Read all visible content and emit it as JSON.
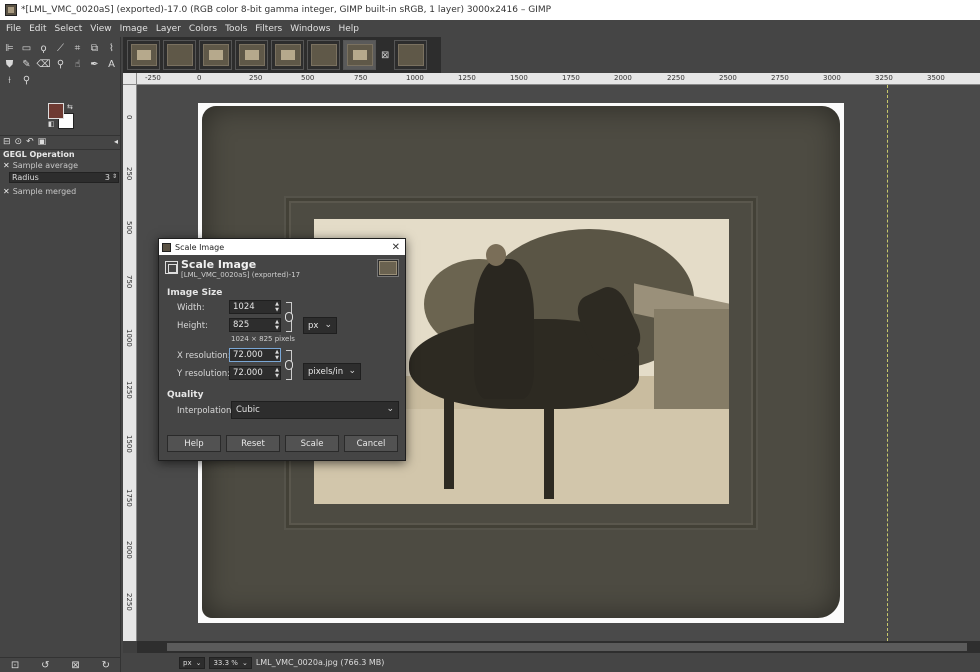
{
  "window": {
    "title": "*[LML_VMC_0020aS] (exported)-17.0 (RGB color 8-bit gamma integer, GIMP built-in sRGB, 1 layer) 3000x2416 – GIMP"
  },
  "menu": [
    "File",
    "Edit",
    "Select",
    "View",
    "Image",
    "Layer",
    "Colors",
    "Tools",
    "Filters",
    "Windows",
    "Help"
  ],
  "tool_options": {
    "title": "GEGL Operation",
    "sample_average": "Sample average",
    "radius_label": "Radius",
    "radius_value": "3",
    "sample_merged": "Sample merged"
  },
  "colors": {
    "foreground": "#6e3a32",
    "background": "#ffffff"
  },
  "rulers": {
    "horizontal": [
      "-250",
      "0",
      "250",
      "500",
      "750",
      "1000",
      "1250",
      "1500",
      "1750",
      "2000",
      "2250",
      "2500",
      "2750",
      "3000",
      "3250",
      "3500"
    ],
    "vertical": [
      "0",
      "250",
      "500",
      "750",
      "1000",
      "1250",
      "1500",
      "1750",
      "2000",
      "2250"
    ]
  },
  "statusbar": {
    "unit": "px",
    "zoom": "33.3 %",
    "file_info": "LML_VMC_0020a.jpg (766.3 MB)"
  },
  "dialog": {
    "title": "Scale Image",
    "header": "Scale Image",
    "subheader": "[LML_VMC_0020aS] (exported)-17",
    "image_size_label": "Image Size",
    "width_label": "Width:",
    "width_value": "1024",
    "height_label": "Height:",
    "height_value": "825",
    "size_unit": "px",
    "pixels_note": "1024 × 825 pixels",
    "xres_label": "X resolution:",
    "xres_value": "72.000",
    "yres_label": "Y resolution:",
    "yres_value": "72.000",
    "res_unit": "pixels/in",
    "quality_label": "Quality",
    "interp_label": "Interpolation:",
    "interp_value": "Cubic",
    "buttons": {
      "help": "Help",
      "reset": "Reset",
      "scale": "Scale",
      "cancel": "Cancel"
    }
  }
}
